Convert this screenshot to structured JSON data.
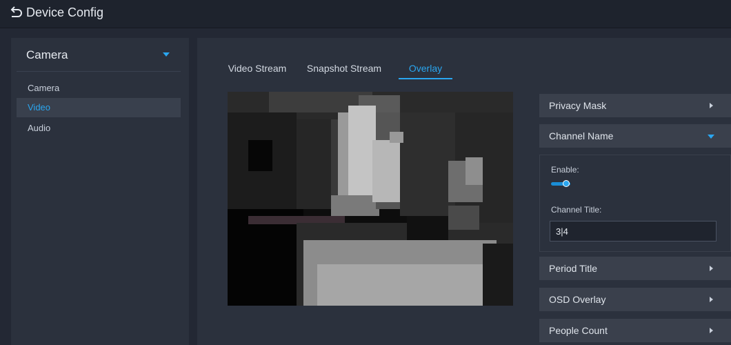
{
  "header": {
    "title": "Device Config"
  },
  "sidebar": {
    "section": "Camera",
    "items": [
      {
        "label": "Camera",
        "active": false
      },
      {
        "label": "Video",
        "active": true
      },
      {
        "label": "Audio",
        "active": false
      }
    ]
  },
  "tabs": [
    {
      "label": "Video Stream",
      "active": false
    },
    {
      "label": "Snapshot Stream",
      "active": false
    },
    {
      "label": "Overlay",
      "active": true
    }
  ],
  "overlay_panels": {
    "privacy_mask": {
      "label": "Privacy Mask",
      "expanded": false
    },
    "channel_name": {
      "label": "Channel Name",
      "expanded": true,
      "enable_label": "Enable:",
      "enabled": true,
      "channel_title_label": "Channel Title:",
      "channel_title_value": "3|4"
    },
    "period_title": {
      "label": "Period Title",
      "expanded": false
    },
    "osd_overlay": {
      "label": "OSD Overlay",
      "expanded": false
    },
    "people_count": {
      "label": "People Count",
      "expanded": false
    }
  },
  "colors": {
    "accent": "#2aa6f0",
    "background": "#232834",
    "panel": "#2b313d"
  }
}
